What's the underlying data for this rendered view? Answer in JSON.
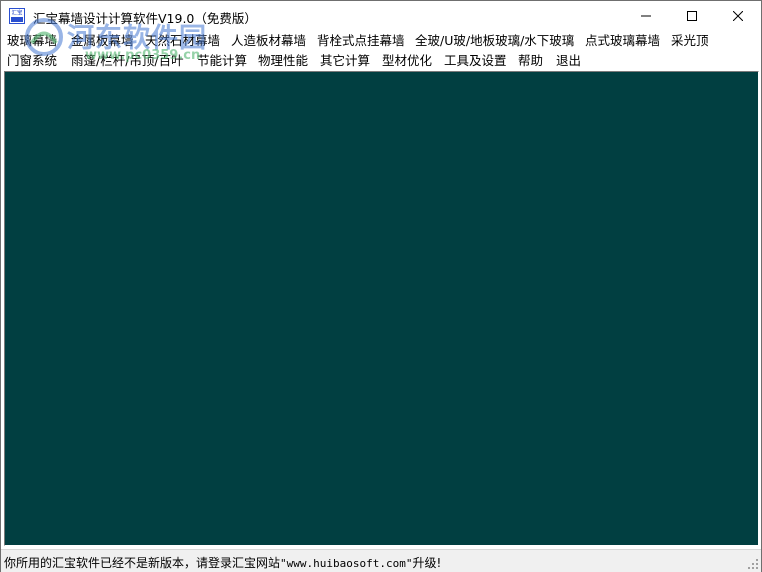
{
  "window": {
    "title": "汇宝幕墙设计计算软件V19.0（免费版）",
    "icon_text": "汇宝",
    "buttons": [
      "minimize-icon",
      "maximize-icon",
      "close-icon"
    ]
  },
  "menu": {
    "row1": [
      {
        "label": "玻璃幕墙"
      },
      {
        "label": "金属板幕墙"
      },
      {
        "label": "天然石材幕墙"
      },
      {
        "label": "人造板材幕墙"
      },
      {
        "label": "背栓式点挂幕墙"
      },
      {
        "label": "全玻/U玻/地板玻璃/水下玻璃"
      },
      {
        "label": "点式玻璃幕墙"
      },
      {
        "label": "采光顶"
      }
    ],
    "row2": [
      {
        "label": "门窗系统"
      },
      {
        "label": "雨篷/栏杆/吊顶/百叶"
      },
      {
        "label": "节能计算"
      },
      {
        "label": "物理性能"
      },
      {
        "label": "其它计算"
      },
      {
        "label": "型材优化"
      },
      {
        "label": "工具及设置"
      },
      {
        "label": "帮助"
      },
      {
        "label": "退出"
      }
    ]
  },
  "watermark": {
    "name": "河东软件园",
    "url": "www.pc0359.cn"
  },
  "colors": {
    "client_background": "#013f41",
    "statusbar_background": "#f0f0f0"
  },
  "status": {
    "prefix": "你所用的汇宝软件已经不是新版本，请登录汇宝网站",
    "url": "\"www.huibaosoft.com\"",
    "suffix": "升级!"
  }
}
